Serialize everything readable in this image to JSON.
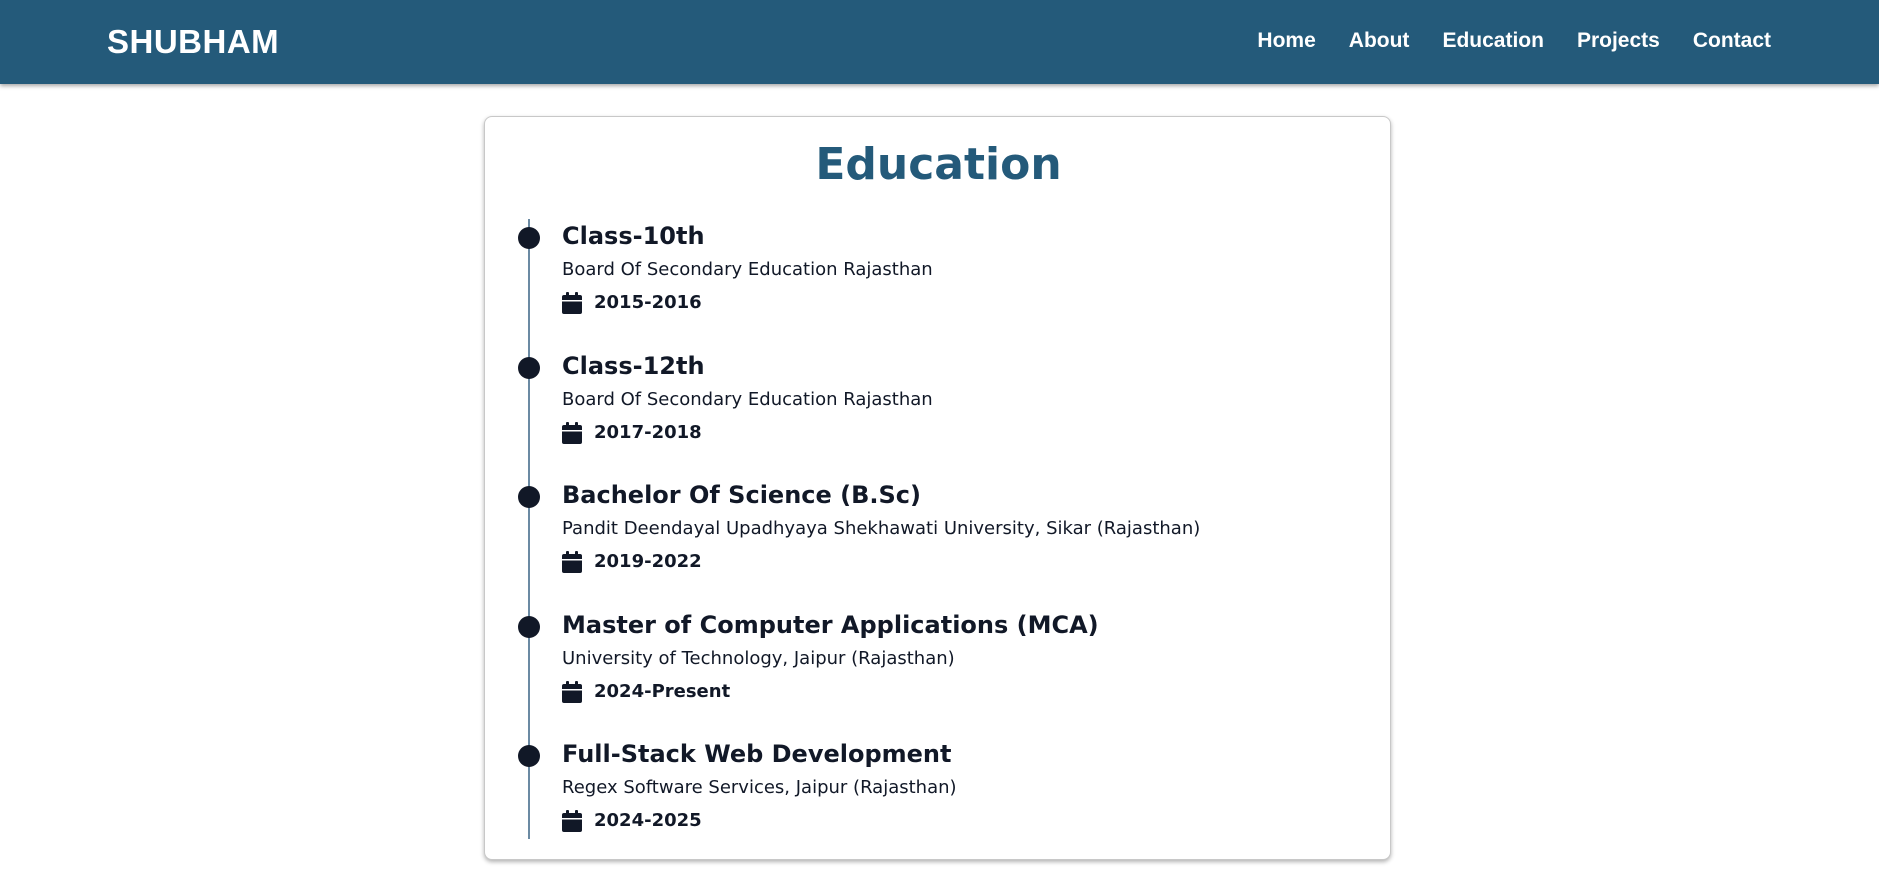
{
  "header": {
    "brand": "SHUBHAM",
    "nav": [
      {
        "label": "Home"
      },
      {
        "label": "About"
      },
      {
        "label": "Education"
      },
      {
        "label": "Projects"
      },
      {
        "label": "Contact"
      }
    ]
  },
  "education": {
    "title": "Education",
    "entries": [
      {
        "title": "Class-10th",
        "institution": "Board Of Secondary Education Rajasthan",
        "date": "2015-2016",
        "icon": "calendar-icon"
      },
      {
        "title": "Class-12th",
        "institution": "Board Of Secondary Education Rajasthan",
        "date": "2017-2018",
        "icon": "calendar-icon"
      },
      {
        "title": "Bachelor Of Science (B.Sc)",
        "institution": "Pandit Deendayal Upadhyaya Shekhawati University, Sikar (Rajasthan)",
        "date": "2019-2022",
        "icon": "calendar-icon"
      },
      {
        "title": "Master of Computer Applications (MCA)",
        "institution": "University of Technology, Jaipur (Rajasthan)",
        "date": "2024-Present",
        "icon": "calendar-icon"
      },
      {
        "title": "Full-Stack Web Development",
        "institution": "Regex Software Services, Jaipur (Rajasthan)",
        "date": "2024-2025",
        "icon": "calendar-icon"
      }
    ]
  },
  "colors": {
    "header_bg": "#245a7a",
    "title": "#245a7a",
    "text": "#111827",
    "timeline": "#6b8aa3"
  }
}
